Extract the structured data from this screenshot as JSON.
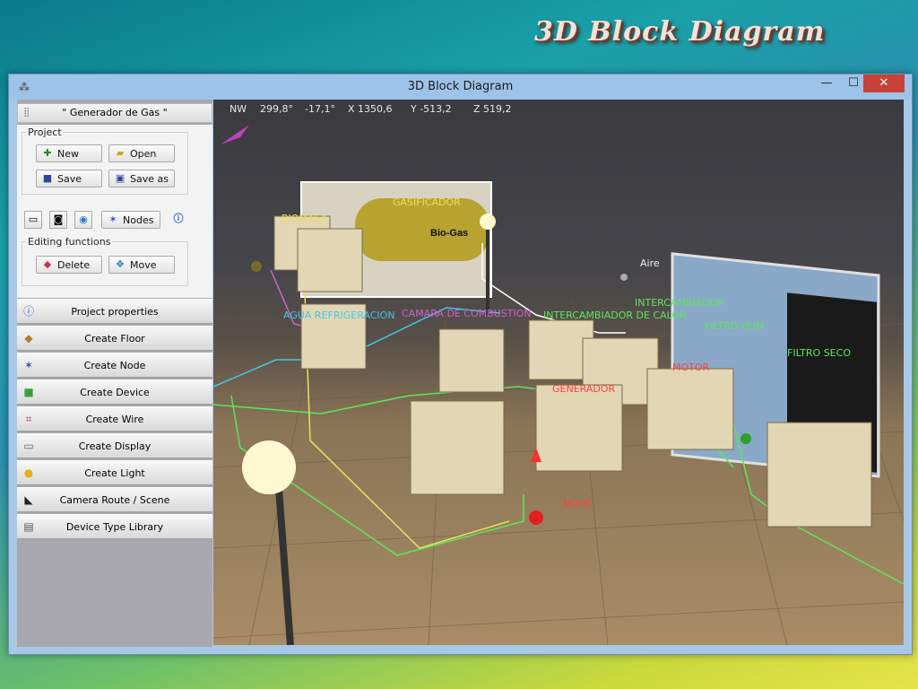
{
  "desktop_title": "3D Block Diagram",
  "window": {
    "title": "3D Block Diagram",
    "min_glyph": "—",
    "max_glyph": "☐",
    "close_glyph": "✕"
  },
  "sidebar": {
    "header": "\" Generador de Gas \"",
    "project_group": "Project",
    "new_label": "New",
    "open_label": "Open",
    "save_label": "Save",
    "saveas_label": "Save as",
    "nodes_label": "Nodes",
    "editing_group": "Editing functions",
    "delete_label": "Delete",
    "move_label": "Move",
    "menu": [
      {
        "label": "Project properties",
        "icon": "info-icon"
      },
      {
        "label": "Create Floor",
        "icon": "floor-icon"
      },
      {
        "label": "Create Node",
        "icon": "node-icon"
      },
      {
        "label": "Create Device",
        "icon": "cube-icon"
      },
      {
        "label": "Create Wire",
        "icon": "wire-icon"
      },
      {
        "label": "Create Display",
        "icon": "display-icon"
      },
      {
        "label": "Create Light",
        "icon": "bulb-icon"
      },
      {
        "label": "Camera Route / Scene",
        "icon": "camera-icon"
      },
      {
        "label": "Device Type Library",
        "icon": "library-icon"
      }
    ]
  },
  "viewport": {
    "compass": "NW",
    "heading": "299,8°",
    "pitch": "-17,1°",
    "x": "X 1350,6",
    "y": "Y -513,2",
    "z": "Z 519,2",
    "labels": {
      "gasificador": "GASIFICADOR",
      "biomasa": "BIOMASA",
      "agua": "AGUA REFRIGERACION",
      "camara": "CAMARA DE COMBUSTION",
      "intercambiador": "INTERCAMBIADOR DE CALOR",
      "intercme": "INTERCAMBIADOR",
      "filtro_hum": "FILTRO HUM",
      "filtro_seco": "FILTRO SECO",
      "aire": "Aire",
      "motor": "MOTOR",
      "generador": "GENERADOR",
      "node": "NODE",
      "biogas": "Bio-Gas"
    },
    "colors": {
      "green": "#5ce65c",
      "yellow": "#e8e060",
      "red": "#ff4040",
      "magenta": "#d060d0",
      "cyan": "#40c8e8"
    }
  }
}
